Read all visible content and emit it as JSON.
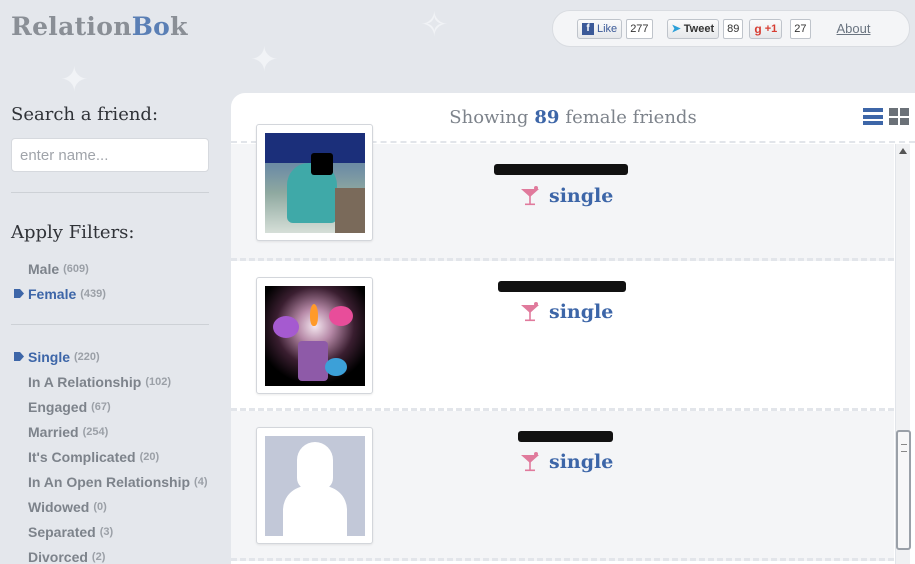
{
  "app": {
    "logo_part1": "Relation",
    "logo_part2": "Bo",
    "logo_part3": "k"
  },
  "social": {
    "facebook": {
      "label": "Like",
      "count": "277"
    },
    "twitter": {
      "label": "Tweet",
      "count": "89"
    },
    "google": {
      "label": "+1",
      "count": "27"
    },
    "about_label": "About"
  },
  "search": {
    "heading": "Search a friend:",
    "placeholder": "enter name..."
  },
  "filters": {
    "heading": "Apply Filters:",
    "gender": [
      {
        "label": "Male",
        "count": "(609)",
        "active": false
      },
      {
        "label": "Female",
        "count": "(439)",
        "active": true
      }
    ],
    "relationship": [
      {
        "label": "Single",
        "count": "(220)",
        "active": true
      },
      {
        "label": "In A Relationship",
        "count": "(102)",
        "active": false
      },
      {
        "label": "Engaged",
        "count": "(67)",
        "active": false
      },
      {
        "label": "Married",
        "count": "(254)",
        "active": false
      },
      {
        "label": "It's Complicated",
        "count": "(20)",
        "active": false
      },
      {
        "label": "In An Open Relationship",
        "count": "(4)",
        "active": false
      },
      {
        "label": "Widowed",
        "count": "(0)",
        "active": false
      },
      {
        "label": "Separated",
        "count": "(3)",
        "active": false
      },
      {
        "label": "Divorced",
        "count": "(2)",
        "active": false
      }
    ]
  },
  "results": {
    "showing_prefix": "Showing",
    "count": "89",
    "showing_suffix": "female friends",
    "friends": [
      {
        "status": "single",
        "photo": "woman-photo"
      },
      {
        "status": "single",
        "photo": "candle-butterflies-photo"
      },
      {
        "status": "single",
        "photo": "default-female-silhouette"
      }
    ]
  },
  "colors": {
    "accent": "#3d66a8",
    "cocktail": "#e07a9c",
    "muted_text": "#7d838b"
  }
}
